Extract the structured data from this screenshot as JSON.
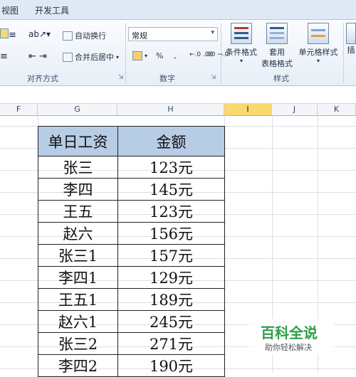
{
  "menu": {
    "view": "视图",
    "developer": "开发工具"
  },
  "alignment_group": {
    "wrap_text": "自动换行",
    "merge_center": "合并后居中",
    "label": "对齐方式"
  },
  "number_group": {
    "format_value": "常规",
    "percent": "%",
    "comma": ",",
    "increase_decimal": "←.0 .00",
    "decrease_decimal": ".00 →.0",
    "label": "数字"
  },
  "styles_group": {
    "conditional_format": "条件格式",
    "table_format_line1": "套用",
    "table_format_line2": "表格格式",
    "cell_styles": "单元格样式",
    "label": "样式"
  },
  "insert_partial": "插",
  "columns": [
    "F",
    "G",
    "H",
    "I",
    "J",
    "K"
  ],
  "table": {
    "header": [
      "单日工资",
      "金额"
    ],
    "rows": [
      [
        "张三",
        "123元"
      ],
      [
        "李四",
        "145元"
      ],
      [
        "王五",
        "123元"
      ],
      [
        "赵六",
        "156元"
      ],
      [
        "张三1",
        "157元"
      ],
      [
        "李四1",
        "129元"
      ],
      [
        "王五1",
        "189元"
      ],
      [
        "赵六1",
        "245元"
      ],
      [
        "张三2",
        "271元"
      ],
      [
        "李四2",
        "190元"
      ]
    ]
  },
  "watermark": {
    "title": "百科全说",
    "subtitle": "助你轻松解决"
  },
  "colors": {
    "header_fill": "#b7cde6",
    "selected_column": "#f8d96e",
    "watermark_green": "#2e9e47"
  }
}
